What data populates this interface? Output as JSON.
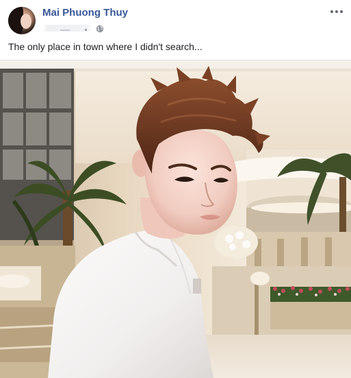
{
  "post": {
    "author_name": "Mai Phuong Thuy",
    "privacy_icon": "globe-icon",
    "more_icon": "more-options-icon",
    "caption": "The only place in town where I didn't search..."
  },
  "colors": {
    "author_link": "#385898",
    "text": "#1c1e21",
    "secondary": "#606770",
    "divider": "#dddfe2"
  }
}
